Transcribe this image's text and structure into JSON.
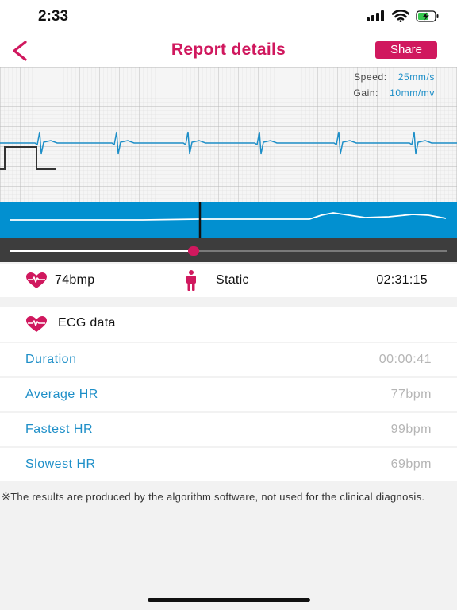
{
  "status_bar": {
    "time": "2:33"
  },
  "nav": {
    "title": "Report details",
    "share_label": "Share"
  },
  "ecg": {
    "speed_label": "Speed:",
    "speed_value": "25mm/s",
    "gain_label": "Gain:",
    "gain_value": "10mm/mv"
  },
  "playback": {
    "progress": 0.42
  },
  "summary": {
    "heart_rate": "74bmp",
    "posture": "Static",
    "time": "02:31:15"
  },
  "section": {
    "title": "ECG data"
  },
  "stats": [
    {
      "label": "Duration",
      "value": "00:00:41"
    },
    {
      "label": "Average HR",
      "value": "77bpm"
    },
    {
      "label": "Fastest HR",
      "value": "99bpm"
    },
    {
      "label": "Slowest HR",
      "value": "69bpm"
    }
  ],
  "disclaimer": "※The results are produced by the algorithm software, not used for the clinical diagnosis.",
  "colors": {
    "accent": "#d0185e",
    "link": "#1e8fc8",
    "trace": "#1e8fc8",
    "overview_bg": "#0290d0"
  }
}
